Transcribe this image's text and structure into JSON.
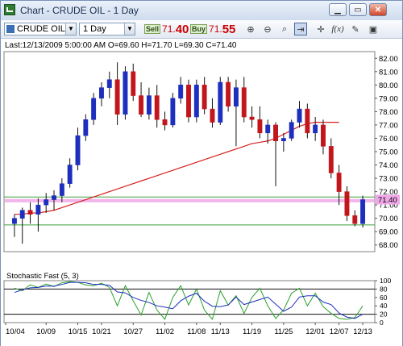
{
  "window": {
    "title": "Chart - CRUDE OIL - 1 Day"
  },
  "toolbar": {
    "symbol": "CRUDE OIL",
    "period": "1 Day",
    "sell_label": "Sell",
    "sell_small": "71.",
    "sell_big": "40",
    "buy_label": "Buy",
    "buy_small": "71.",
    "buy_big": "55"
  },
  "info_line": "Last:12/13/2009 5:00:00 AM O=69.60 H=71.70 L=69.30 C=71.40",
  "colors": {
    "up": "#1c2fbd",
    "down": "#c2161c",
    "ma": "#d62020",
    "support": "#3aa23a",
    "price_band": "#f0a8e8",
    "stoch_k": "#2aa02a",
    "stoch_d": "#1c2fbd"
  },
  "chart_data": [
    {
      "type": "candlestick",
      "title": "",
      "ylim": [
        67.5,
        82.5
      ],
      "y_ticks": [
        "82.00",
        "81.00",
        "80.00",
        "79.00",
        "78.00",
        "77.00",
        "76.00",
        "75.00",
        "74.00",
        "73.00",
        "72.00",
        "71.00",
        "70.00",
        "69.00",
        "68.00"
      ],
      "x_ticks": [
        "10/04",
        "10/09",
        "10/15",
        "10/21",
        "10/27",
        "11/02",
        "11/08",
        "11/13",
        "11/19",
        "11/25",
        "12/01",
        "12/07",
        "12/13"
      ],
      "last_price_label": "71.40",
      "horizontal_lines": [
        71.6,
        69.5
      ],
      "price_band": [
        71.2,
        71.45
      ],
      "candles": [
        {
          "o": 69.6,
          "h": 70.3,
          "l": 68.6,
          "c": 70.0
        },
        {
          "o": 70.0,
          "h": 70.8,
          "l": 68.1,
          "c": 70.6
        },
        {
          "o": 70.6,
          "h": 71.2,
          "l": 69.6,
          "c": 70.3
        },
        {
          "o": 70.3,
          "h": 71.5,
          "l": 69.0,
          "c": 71.0
        },
        {
          "o": 71.0,
          "h": 71.9,
          "l": 70.4,
          "c": 71.4
        },
        {
          "o": 71.4,
          "h": 72.1,
          "l": 70.6,
          "c": 71.7
        },
        {
          "o": 71.7,
          "h": 73.0,
          "l": 71.2,
          "c": 72.6
        },
        {
          "o": 72.6,
          "h": 74.5,
          "l": 72.3,
          "c": 74.0
        },
        {
          "o": 74.0,
          "h": 76.8,
          "l": 73.6,
          "c": 76.2
        },
        {
          "o": 76.2,
          "h": 77.8,
          "l": 75.8,
          "c": 77.4
        },
        {
          "o": 77.4,
          "h": 79.4,
          "l": 77.0,
          "c": 79.0
        },
        {
          "o": 79.0,
          "h": 80.2,
          "l": 78.4,
          "c": 79.8
        },
        {
          "o": 79.8,
          "h": 81.0,
          "l": 79.0,
          "c": 80.4
        },
        {
          "o": 80.4,
          "h": 81.7,
          "l": 77.0,
          "c": 77.8
        },
        {
          "o": 77.8,
          "h": 81.4,
          "l": 77.4,
          "c": 81.0
        },
        {
          "o": 81.0,
          "h": 81.6,
          "l": 78.8,
          "c": 79.2
        },
        {
          "o": 79.2,
          "h": 80.2,
          "l": 77.6,
          "c": 77.8
        },
        {
          "o": 77.8,
          "h": 79.8,
          "l": 77.4,
          "c": 79.2
        },
        {
          "o": 79.2,
          "h": 80.0,
          "l": 76.8,
          "c": 77.4
        },
        {
          "o": 77.4,
          "h": 78.0,
          "l": 76.6,
          "c": 77.0
        },
        {
          "o": 77.0,
          "h": 79.4,
          "l": 76.8,
          "c": 79.0
        },
        {
          "o": 79.0,
          "h": 80.6,
          "l": 78.6,
          "c": 80.0
        },
        {
          "o": 80.0,
          "h": 80.4,
          "l": 77.2,
          "c": 77.6
        },
        {
          "o": 77.6,
          "h": 80.4,
          "l": 77.2,
          "c": 80.0
        },
        {
          "o": 80.0,
          "h": 80.6,
          "l": 77.8,
          "c": 78.2
        },
        {
          "o": 78.2,
          "h": 79.0,
          "l": 76.8,
          "c": 77.2
        },
        {
          "o": 77.2,
          "h": 80.6,
          "l": 77.0,
          "c": 80.2
        },
        {
          "o": 80.2,
          "h": 80.6,
          "l": 78.0,
          "c": 78.4
        },
        {
          "o": 78.4,
          "h": 80.4,
          "l": 75.4,
          "c": 79.8
        },
        {
          "o": 79.8,
          "h": 80.6,
          "l": 77.2,
          "c": 77.6
        },
        {
          "o": 77.6,
          "h": 78.4,
          "l": 76.8,
          "c": 77.4
        },
        {
          "o": 77.4,
          "h": 78.4,
          "l": 76.0,
          "c": 76.4
        },
        {
          "o": 76.4,
          "h": 77.4,
          "l": 75.6,
          "c": 77.0
        },
        {
          "o": 77.0,
          "h": 77.2,
          "l": 72.4,
          "c": 75.8
        },
        {
          "o": 75.8,
          "h": 76.4,
          "l": 75.0,
          "c": 76.0
        },
        {
          "o": 76.0,
          "h": 77.4,
          "l": 75.8,
          "c": 77.2
        },
        {
          "o": 77.2,
          "h": 78.8,
          "l": 76.8,
          "c": 78.2
        },
        {
          "o": 78.2,
          "h": 78.6,
          "l": 76.0,
          "c": 76.4
        },
        {
          "o": 76.4,
          "h": 77.6,
          "l": 75.8,
          "c": 77.0
        },
        {
          "o": 77.0,
          "h": 77.4,
          "l": 74.8,
          "c": 75.4
        },
        {
          "o": 75.4,
          "h": 76.0,
          "l": 73.0,
          "c": 73.4
        },
        {
          "o": 73.4,
          "h": 74.0,
          "l": 71.0,
          "c": 72.0
        },
        {
          "o": 72.0,
          "h": 72.4,
          "l": 69.8,
          "c": 70.2
        },
        {
          "o": 70.2,
          "h": 70.6,
          "l": 69.4,
          "c": 69.6
        },
        {
          "o": 69.6,
          "h": 71.7,
          "l": 69.3,
          "c": 71.4
        }
      ],
      "moving_average": [
        70.3,
        70.3,
        70.4,
        70.4,
        70.5,
        70.6,
        70.8,
        71.0,
        71.2,
        71.4,
        71.6,
        71.8,
        72.0,
        72.2,
        72.4,
        72.6,
        72.8,
        73.0,
        73.2,
        73.4,
        73.6,
        73.8,
        74.0,
        74.2,
        74.4,
        74.6,
        74.8,
        75.0,
        75.2,
        75.4,
        75.6,
        75.7,
        75.8,
        76.0,
        76.3,
        76.6,
        76.9,
        77.1,
        77.2,
        77.2,
        77.2,
        77.2
      ]
    },
    {
      "type": "line",
      "title": "Stochastic Fast (5, 3)",
      "ylim": [
        0,
        100
      ],
      "y_ticks": [
        "100",
        "80",
        "60",
        "40",
        "20",
        "0"
      ],
      "horizontal_lines": [
        80,
        20
      ],
      "series": [
        {
          "values": [
            82,
            76,
            90,
            84,
            92,
            86,
            95,
            98,
            96,
            90,
            88,
            94,
            84,
            40,
            88,
            52,
            18,
            72,
            30,
            8,
            60,
            88,
            42,
            80,
            30,
            8,
            76,
            42,
            64,
            22,
            60,
            82,
            40,
            10,
            30,
            70,
            82,
            40,
            70,
            38,
            22,
            10,
            8,
            12,
            40
          ]
        },
        {
          "values": [
            72,
            78,
            83,
            84,
            87,
            87,
            91,
            96,
            96,
            95,
            91,
            91,
            89,
            73,
            71,
            60,
            53,
            48,
            40,
            37,
            33,
            52,
            63,
            70,
            51,
            39,
            38,
            42,
            61,
            43,
            49,
            55,
            61,
            44,
            27,
            37,
            61,
            64,
            64,
            49,
            43,
            23,
            13,
            10,
            20
          ]
        }
      ]
    }
  ]
}
